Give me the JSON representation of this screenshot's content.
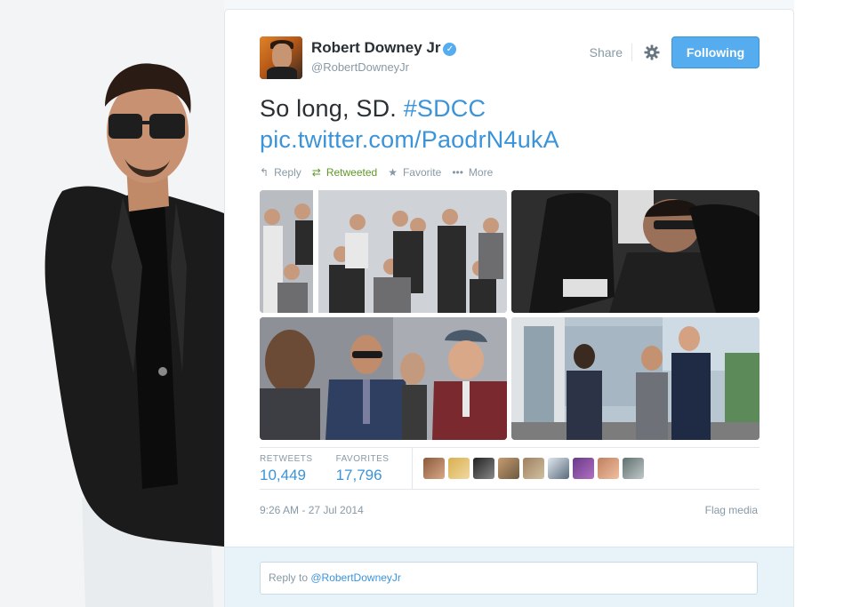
{
  "tweet": {
    "author": {
      "fullname": "Robert Downey Jr",
      "username": "@RobertDowneyJr",
      "verified_icon": "verified-badge-icon"
    },
    "header_actions": {
      "share_label": "Share",
      "gear_icon": "gear-icon",
      "follow_label": "Following"
    },
    "text_plain": "So long, SD. ",
    "hashtag": "#SDCC",
    "pic_link": "pic.twitter.com/PaodrN4ukA",
    "actions": {
      "reply": "Reply",
      "retweeted": "Retweeted",
      "favorite": "Favorite",
      "more": "More"
    },
    "stats": {
      "retweets_label": "RETWEETS",
      "retweets_value": "10,449",
      "favorites_label": "FAVORITES",
      "favorites_value": "17,796"
    },
    "favoriter_avatar_count": 9,
    "timestamp": "9:26 AM - 27 Jul 2014",
    "flag_media": "Flag media"
  },
  "reply": {
    "prefix": "Reply to ",
    "mention": "@RobertDowneyJr"
  },
  "colors": {
    "link": "#3b94d9",
    "follow_button": "#55acee",
    "retweeted": "#609928",
    "muted": "#8899a6"
  }
}
